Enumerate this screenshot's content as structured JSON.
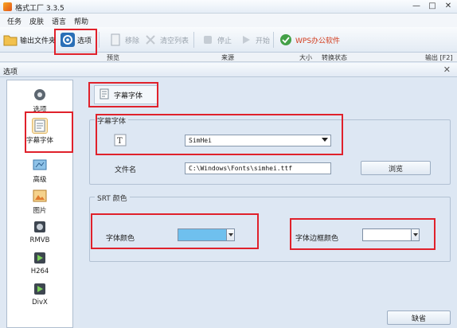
{
  "window": {
    "title": "格式工厂 3.3.5",
    "menu": [
      "任务",
      "皮肤",
      "语言",
      "帮助"
    ]
  },
  "toolbar": {
    "output_folder": "输出文件夹",
    "options": "选项",
    "remove": "移除",
    "clear_list": "清空列表",
    "stop": "停止",
    "start": "开始",
    "wps": "WPS办公软件"
  },
  "file_list": {
    "columns": [
      "预览",
      "来源",
      "大小",
      "转换状态",
      "输出 [F2]"
    ]
  },
  "dialog": {
    "title": "选项",
    "sidebar": [
      "选项",
      "字幕字体",
      "高级",
      "图片",
      "RMVB",
      "H264",
      "DivX"
    ],
    "tab": "字幕字体",
    "font_group_label": "字幕字体",
    "font_value": "SimHei",
    "file_label": "文件名",
    "file_path": "C:\\Windows\\Fonts\\simhei.ttf",
    "browse": "浏览",
    "color_group_label": "SRT 颜色",
    "font_color_label": "字体颜色",
    "border_color_label": "字体边框颜色",
    "default_button": "缺省"
  },
  "colors": {
    "font_color": "#6fc0ee",
    "border_color": "#ffffff",
    "highlight": "#e0212b"
  }
}
